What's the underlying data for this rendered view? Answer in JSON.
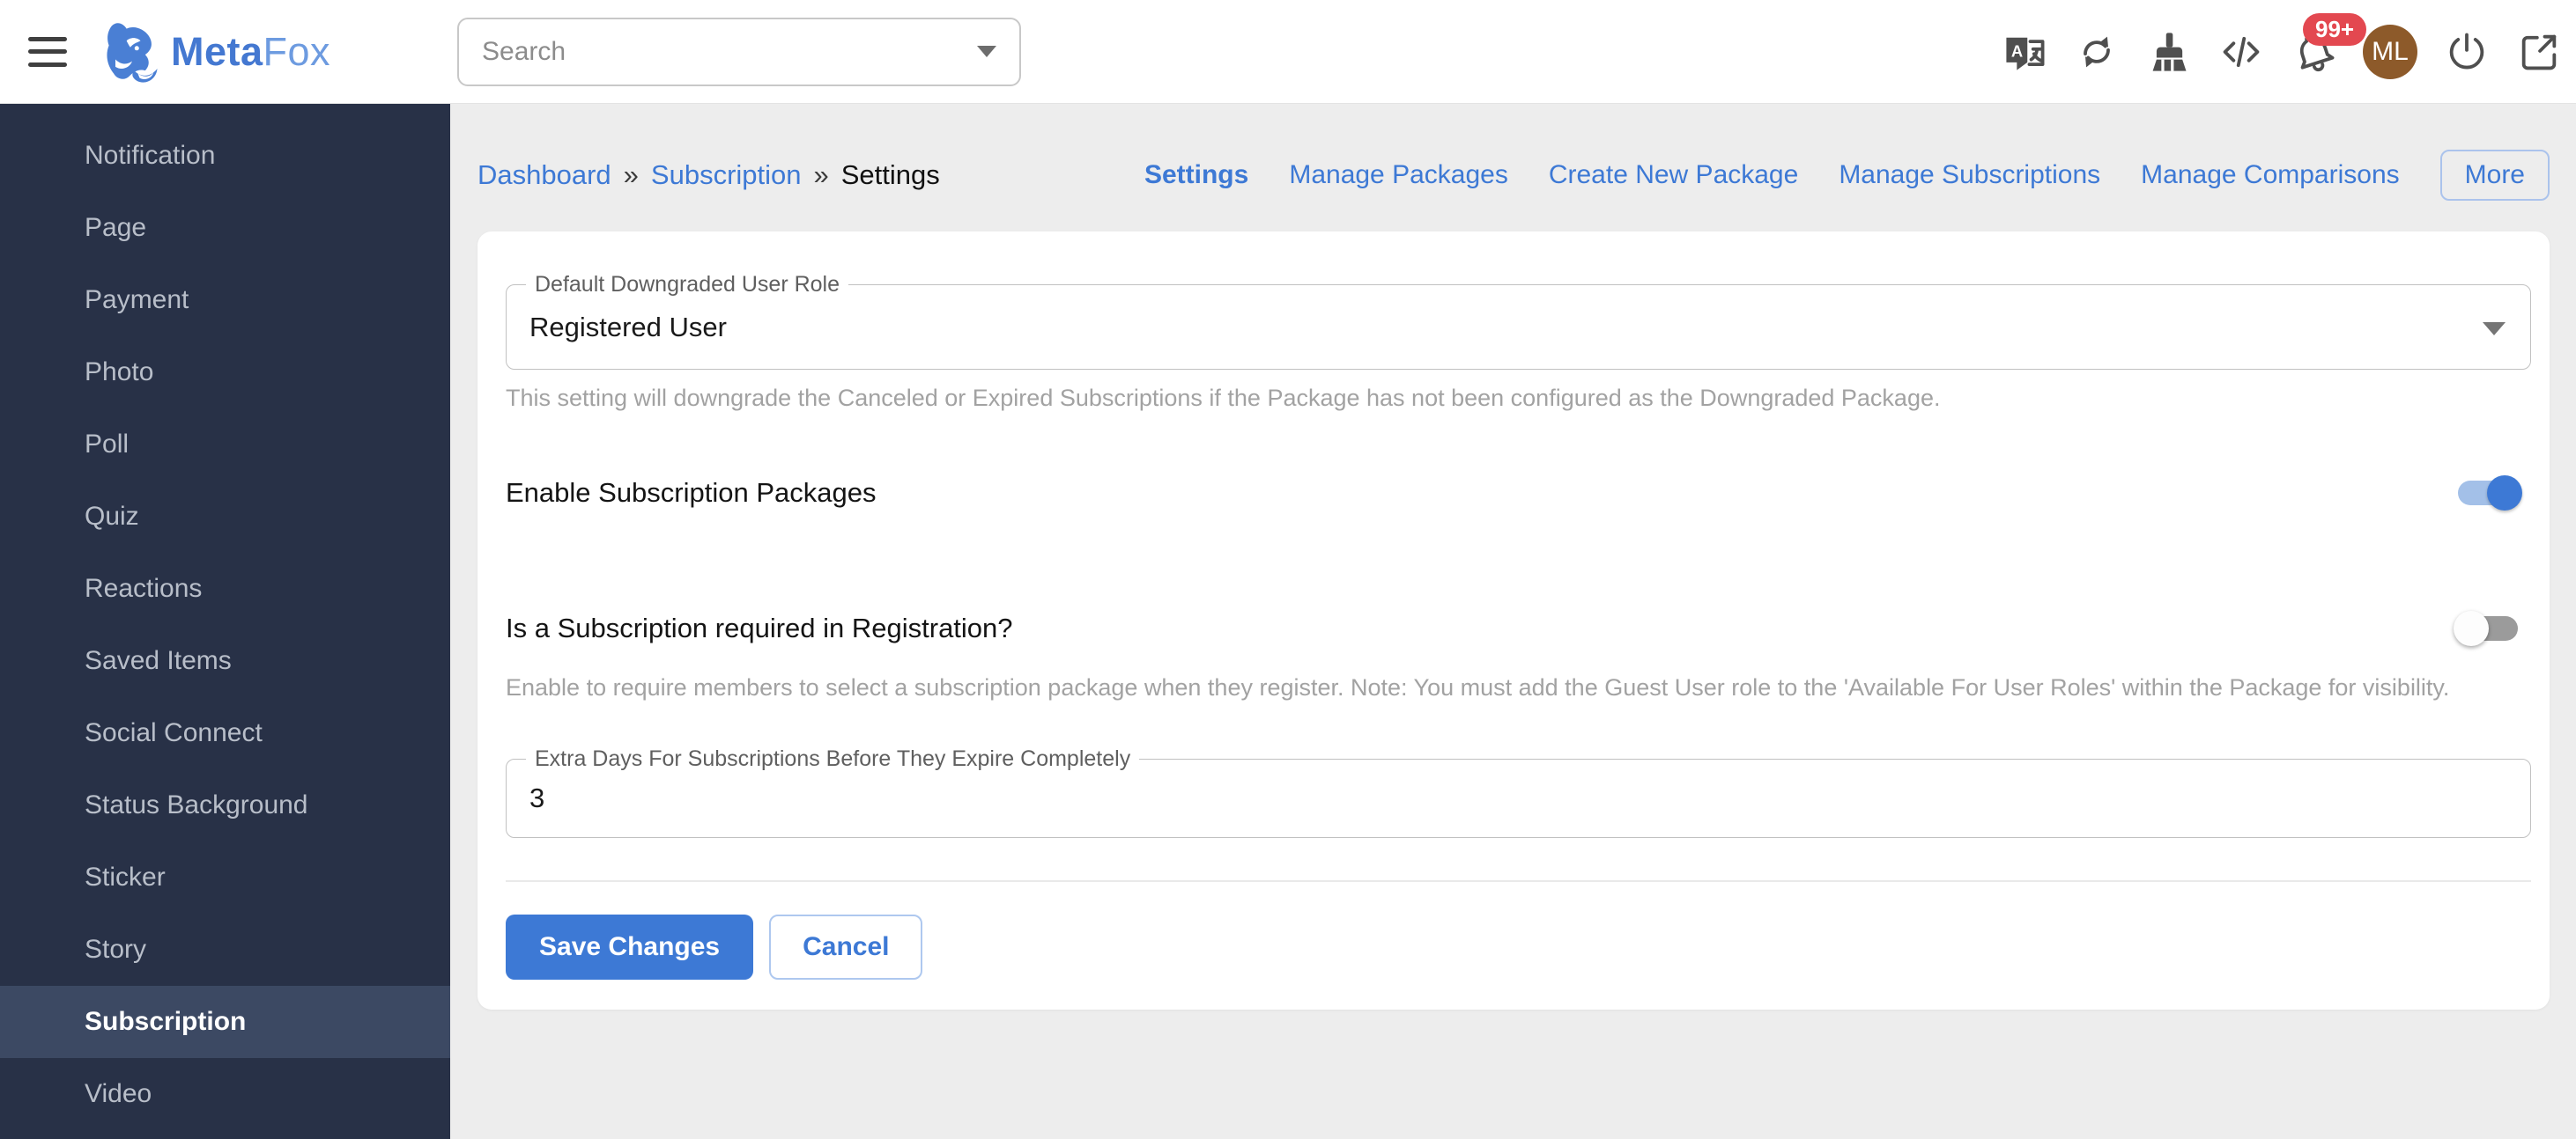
{
  "header": {
    "logo": {
      "meta": "Meta",
      "fox": "Fox"
    },
    "search": {
      "placeholder": "Search"
    },
    "icons": [
      "translate-icon",
      "sync-icon",
      "clean-brush-icon",
      "code-icon",
      "notifications-bell-icon",
      "avatar",
      "power-icon",
      "open-in-new-icon"
    ],
    "badge": "99+",
    "avatar": "ML"
  },
  "sidebar": {
    "items": [
      {
        "label": "Notification",
        "active": false
      },
      {
        "label": "Page",
        "active": false
      },
      {
        "label": "Payment",
        "active": false
      },
      {
        "label": "Photo",
        "active": false
      },
      {
        "label": "Poll",
        "active": false
      },
      {
        "label": "Quiz",
        "active": false
      },
      {
        "label": "Reactions",
        "active": false
      },
      {
        "label": "Saved Items",
        "active": false
      },
      {
        "label": "Social Connect",
        "active": false
      },
      {
        "label": "Status Background",
        "active": false
      },
      {
        "label": "Sticker",
        "active": false
      },
      {
        "label": "Story",
        "active": false
      },
      {
        "label": "Subscription",
        "active": true
      },
      {
        "label": "Video",
        "active": false
      }
    ]
  },
  "breadcrumb": {
    "items": [
      "Dashboard",
      "Subscription",
      "Settings"
    ],
    "separator": "»"
  },
  "tabs": [
    {
      "label": "Settings",
      "active": true
    },
    {
      "label": "Manage Packages",
      "active": false
    },
    {
      "label": "Create New Package",
      "active": false
    },
    {
      "label": "Manage Subscriptions",
      "active": false
    },
    {
      "label": "Manage Comparisons",
      "active": false
    }
  ],
  "more_label": "More",
  "form": {
    "role_field": {
      "label": "Default Downgraded User Role",
      "value": "Registered User",
      "helper": "This setting will downgrade the Canceled or Expired Subscriptions if the Package has not been configured as the Downgraded Package."
    },
    "enable_packages": {
      "label": "Enable Subscription Packages",
      "enabled": true
    },
    "require_registration": {
      "label": "Is a Subscription required in Registration?",
      "enabled": false,
      "helper": "Enable to require members to select a subscription package when they register. Note: You must add the Guest User role to the 'Available For User Roles' within the Package for visibility."
    },
    "extra_days": {
      "label": "Extra Days For Subscriptions Before They Expire Completely",
      "value": "3"
    },
    "buttons": {
      "save": "Save Changes",
      "cancel": "Cancel"
    }
  },
  "colors": {
    "accent_blue": "#3d79d5",
    "sidebar_bg": "#283147",
    "sidebar_active_bg": "#3c4963",
    "content_bg": "#ededed",
    "badge_red": "#e34850",
    "avatar_brown": "#8d5a2a",
    "toggle_on_track": "#a3c0e8",
    "toggle_off_track": "#9b9b9b"
  }
}
